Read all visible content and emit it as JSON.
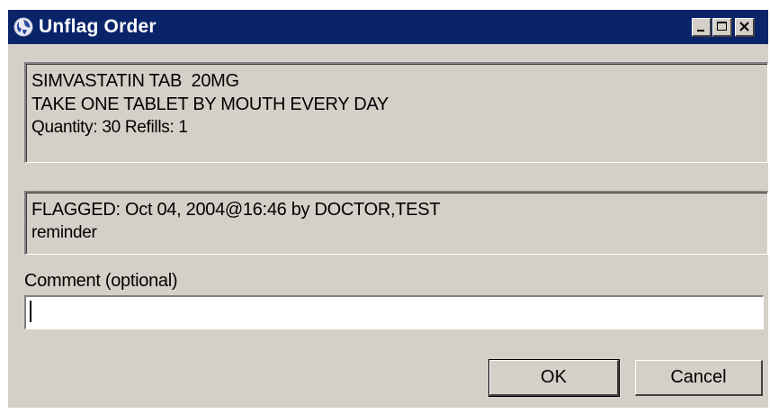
{
  "window": {
    "title": "Unflag Order"
  },
  "order": {
    "line1": "SIMVASTATIN TAB  20MG",
    "line2": "TAKE ONE TABLET BY MOUTH EVERY DAY",
    "line3": "Quantity: 30 Refills: 1"
  },
  "flag": {
    "line1": "FLAGGED: Oct 04, 2004@16:46 by DOCTOR,TEST",
    "line2": "reminder"
  },
  "comment": {
    "label": "Comment (optional)",
    "value": ""
  },
  "buttons": {
    "ok": "OK",
    "cancel": "Cancel"
  },
  "colors": {
    "titlebar": "#0a246a",
    "face": "#d4d0c8"
  }
}
